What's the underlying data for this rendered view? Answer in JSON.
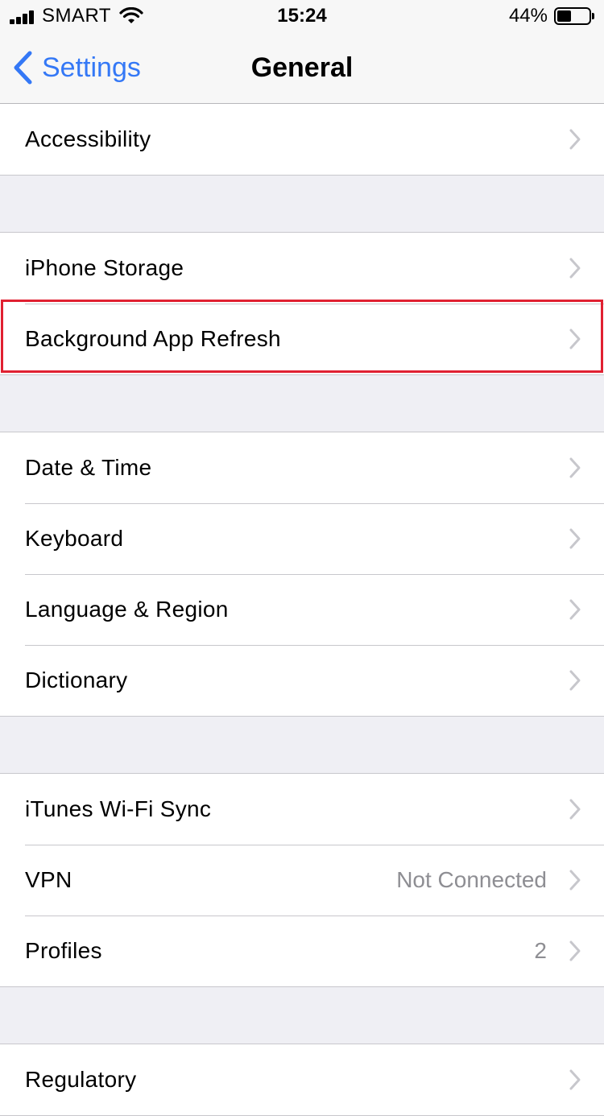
{
  "status_bar": {
    "carrier": "SMART",
    "time": "15:24",
    "battery_percent": "44%",
    "battery_level": 0.44,
    "signal_icon": "cellular-signal-icon",
    "wifi_icon": "wifi-icon",
    "battery_icon": "battery-icon"
  },
  "nav": {
    "back_label": "Settings",
    "title": "General",
    "accent_color": "#3478f6"
  },
  "groups": [
    {
      "rows": [
        {
          "label": "Accessibility"
        }
      ]
    },
    {
      "rows": [
        {
          "label": "iPhone Storage"
        },
        {
          "label": "Background App Refresh",
          "highlighted": true
        }
      ]
    },
    {
      "rows": [
        {
          "label": "Date & Time"
        },
        {
          "label": "Keyboard"
        },
        {
          "label": "Language & Region"
        },
        {
          "label": "Dictionary"
        }
      ]
    },
    {
      "rows": [
        {
          "label": "iTunes Wi-Fi Sync"
        },
        {
          "label": "VPN",
          "detail": "Not Connected"
        },
        {
          "label": "Profiles",
          "detail": "2"
        }
      ]
    },
    {
      "rows": [
        {
          "label": "Regulatory"
        }
      ]
    }
  ],
  "highlight_color": "#e02031"
}
